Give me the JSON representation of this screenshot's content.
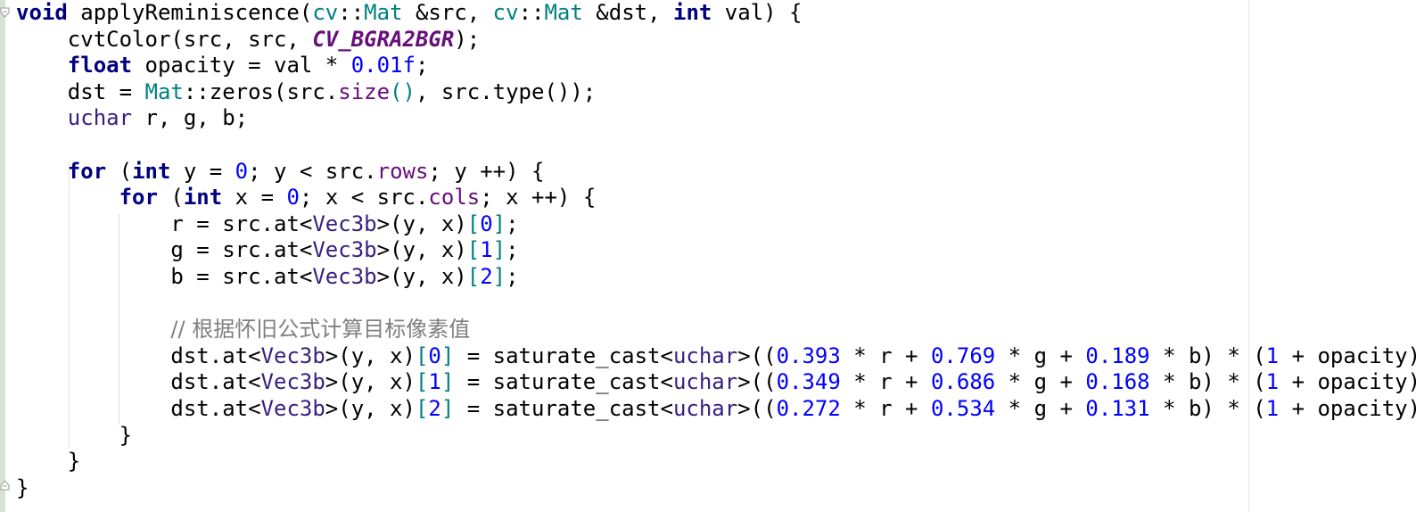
{
  "editor": {
    "language": "C++",
    "lines": [
      [
        [
          "kw",
          "void"
        ],
        [
          "t",
          " applyReminiscence("
        ],
        [
          "ns",
          "cv"
        ],
        [
          "t",
          "::"
        ],
        [
          "ns",
          "Mat"
        ],
        [
          "t",
          " &src, "
        ],
        [
          "ns",
          "cv"
        ],
        [
          "t",
          "::"
        ],
        [
          "ns",
          "Mat"
        ],
        [
          "t",
          " &dst, "
        ],
        [
          "kw",
          "int"
        ],
        [
          "t",
          " val) {"
        ]
      ],
      [
        [
          "t",
          "    cvtColor(src, src, "
        ],
        [
          "macro",
          "CV_BGRA2BGR"
        ],
        [
          "t",
          ");"
        ]
      ],
      [
        [
          "t",
          "    "
        ],
        [
          "kw",
          "float"
        ],
        [
          "t",
          " opacity = val * "
        ],
        [
          "num",
          "0.01f"
        ],
        [
          "t",
          ";"
        ]
      ],
      [
        [
          "t",
          "    dst = "
        ],
        [
          "ns",
          "Mat"
        ],
        [
          "t",
          "::zeros(src."
        ],
        [
          "mem",
          "size"
        ],
        [
          "ns",
          "()"
        ],
        [
          "t",
          ", src.type());"
        ]
      ],
      [
        [
          "t",
          "    "
        ],
        [
          "ty",
          "uchar"
        ],
        [
          "t",
          " r, g, b;"
        ]
      ],
      [
        [
          "t",
          ""
        ]
      ],
      [
        [
          "t",
          "    "
        ],
        [
          "kw",
          "for"
        ],
        [
          "t",
          " ("
        ],
        [
          "kw",
          "int"
        ],
        [
          "t",
          " y = "
        ],
        [
          "num",
          "0"
        ],
        [
          "t",
          "; y < src."
        ],
        [
          "mem",
          "rows"
        ],
        [
          "t",
          "; y ++) {"
        ]
      ],
      [
        [
          "t",
          "        "
        ],
        [
          "kw",
          "for"
        ],
        [
          "t",
          " ("
        ],
        [
          "kw",
          "int"
        ],
        [
          "t",
          " x = "
        ],
        [
          "num",
          "0"
        ],
        [
          "t",
          "; x < src."
        ],
        [
          "mem",
          "cols"
        ],
        [
          "t",
          "; x ++) {"
        ]
      ],
      [
        [
          "t",
          "            r = src.at<"
        ],
        [
          "ty",
          "Vec3b"
        ],
        [
          "t",
          ">(y, x)"
        ],
        [
          "ns",
          "["
        ],
        [
          "num",
          "0"
        ],
        [
          "ns",
          "]"
        ],
        [
          "t",
          ";"
        ]
      ],
      [
        [
          "t",
          "            g = src.at<"
        ],
        [
          "ty",
          "Vec3b"
        ],
        [
          "t",
          ">(y, x)"
        ],
        [
          "ns",
          "["
        ],
        [
          "num",
          "1"
        ],
        [
          "ns",
          "]"
        ],
        [
          "t",
          ";"
        ]
      ],
      [
        [
          "t",
          "            b = src.at<"
        ],
        [
          "ty",
          "Vec3b"
        ],
        [
          "t",
          ">(y, x)"
        ],
        [
          "ns",
          "["
        ],
        [
          "num",
          "2"
        ],
        [
          "ns",
          "]"
        ],
        [
          "t",
          ";"
        ]
      ],
      [
        [
          "t",
          ""
        ]
      ],
      [
        [
          "t",
          "            "
        ],
        [
          "cmt",
          "// 根据怀旧公式计算目标像素值"
        ]
      ],
      [
        [
          "t",
          "            dst.at<"
        ],
        [
          "ty",
          "Vec3b"
        ],
        [
          "t",
          ">(y, x)"
        ],
        [
          "ns",
          "["
        ],
        [
          "num",
          "0"
        ],
        [
          "ns",
          "]"
        ],
        [
          "t",
          " = saturate_cast<"
        ],
        [
          "ty",
          "uchar"
        ],
        [
          "t",
          ">(("
        ],
        [
          "num",
          "0.393"
        ],
        [
          "t",
          " * r + "
        ],
        [
          "num",
          "0.769"
        ],
        [
          "t",
          " * g + "
        ],
        [
          "num",
          "0.189"
        ],
        [
          "t",
          " * b) * ("
        ],
        [
          "num",
          "1"
        ],
        [
          "t",
          " + opacity));"
        ]
      ],
      [
        [
          "t",
          "            dst.at<"
        ],
        [
          "ty",
          "Vec3b"
        ],
        [
          "t",
          ">(y, x)"
        ],
        [
          "ns",
          "["
        ],
        [
          "num",
          "1"
        ],
        [
          "ns",
          "]"
        ],
        [
          "t",
          " = saturate_cast<"
        ],
        [
          "ty",
          "uchar"
        ],
        [
          "t",
          ">(("
        ],
        [
          "num",
          "0.349"
        ],
        [
          "t",
          " * r + "
        ],
        [
          "num",
          "0.686"
        ],
        [
          "t",
          " * g + "
        ],
        [
          "num",
          "0.168"
        ],
        [
          "t",
          " * b) * ("
        ],
        [
          "num",
          "1"
        ],
        [
          "t",
          " + opacity));"
        ]
      ],
      [
        [
          "t",
          "            dst.at<"
        ],
        [
          "ty",
          "Vec3b"
        ],
        [
          "t",
          ">(y, x)"
        ],
        [
          "ns",
          "["
        ],
        [
          "num",
          "2"
        ],
        [
          "ns",
          "]"
        ],
        [
          "t",
          " = saturate_cast<"
        ],
        [
          "ty",
          "uchar"
        ],
        [
          "t",
          ">(("
        ],
        [
          "num",
          "0.272"
        ],
        [
          "t",
          " * r + "
        ],
        [
          "num",
          "0.534"
        ],
        [
          "t",
          " * g + "
        ],
        [
          "num",
          "0.131"
        ],
        [
          "t",
          " * b) * ("
        ],
        [
          "num",
          "1"
        ],
        [
          "t",
          " + opacity));"
        ]
      ],
      [
        [
          "t",
          "        }"
        ]
      ],
      [
        [
          "t",
          "    }"
        ]
      ],
      [
        [
          "t",
          "}"
        ]
      ]
    ]
  },
  "colors": {
    "keyword": "#000080",
    "namespace": "#008080",
    "type": "#371f80",
    "member": "#660e7a",
    "number": "#0000ff",
    "comment": "#808080",
    "gutter": "#d7e4d3"
  },
  "icons": {
    "fold_open": "fold-open-icon",
    "fold_close": "fold-close-icon"
  }
}
